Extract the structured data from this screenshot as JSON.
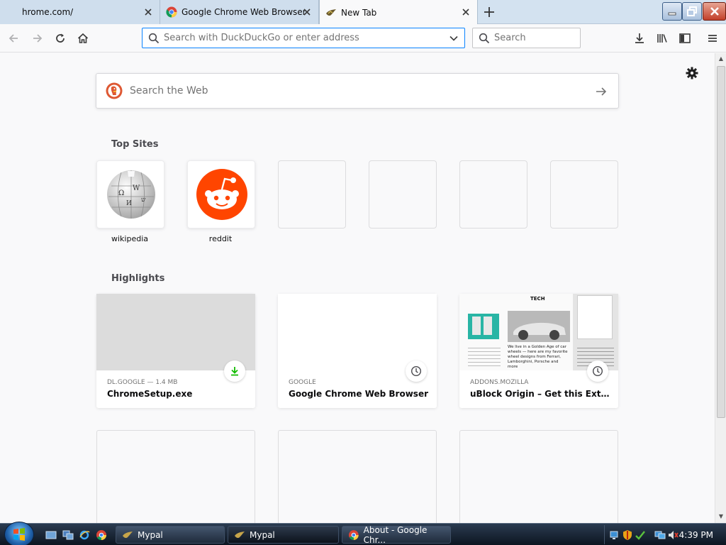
{
  "tabs": [
    {
      "title": "hrome.com/",
      "active": false
    },
    {
      "title": "Google Chrome Web Browser",
      "active": false
    },
    {
      "title": "New Tab",
      "active": true
    }
  ],
  "navbar": {
    "url_placeholder": "Search with DuckDuckGo or enter address",
    "search_placeholder": "Search"
  },
  "newtab": {
    "web_search_placeholder": "Search the Web",
    "top_sites_heading": "Top Sites",
    "top_sites": [
      {
        "label": "wikipedia",
        "icon": "wikipedia-globe"
      },
      {
        "label": "reddit",
        "icon": "reddit-alien"
      },
      {
        "label": "",
        "icon": ""
      },
      {
        "label": "",
        "icon": ""
      },
      {
        "label": "",
        "icon": ""
      },
      {
        "label": "",
        "icon": ""
      }
    ],
    "highlights_heading": "Highlights",
    "highlights": [
      {
        "context": "DL.GOOGLE — 1.4 MB",
        "title": "ChromeSetup.exe",
        "badge": "download-icon"
      },
      {
        "context": "GOOGLE",
        "title": "Google Chrome Web Browser",
        "badge": "clock-icon"
      },
      {
        "context": "ADDONS.MOZILLA",
        "title": "uBlock Origin – Get this Extensio...",
        "badge": "clock-icon"
      }
    ],
    "thumb_text": {
      "tech": "TECH",
      "headline": "We live in a Golden Age of car wheels — here are my favorite wheel designs from Ferrari, Lamborghini, Porsche and more"
    }
  },
  "taskbar": {
    "tasks": [
      {
        "label": "Mypal",
        "active": false
      },
      {
        "label": "Mypal",
        "active": true
      },
      {
        "label": "About - Google Chr...",
        "active": false
      }
    ],
    "clock": "4:39 PM"
  },
  "colors": {
    "accent": "#0a84ff",
    "reddit": "#ff4500",
    "download_green": "#12bc00",
    "ddg": "#de5833"
  }
}
